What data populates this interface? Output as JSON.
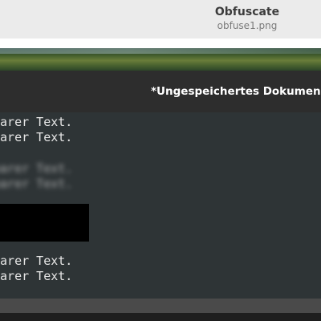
{
  "app": {
    "title": "Obfuscate",
    "subtitle": "obfuse1.png"
  },
  "editor": {
    "document_title": "*Ungespeichertes Dokumen",
    "lines": {
      "line1": "parer Text.",
      "line2": "parer Text.",
      "blurred1": "parer Text.",
      "blurred2": "parer Text.",
      "line5": "parer Text.",
      "line6": "parer Text."
    }
  },
  "colors": {
    "header_bg": "#ebebeb",
    "editor_titlebar_bg": "#2d2d2d",
    "editor_body_bg": "#2e3436",
    "redaction": "#000000"
  }
}
